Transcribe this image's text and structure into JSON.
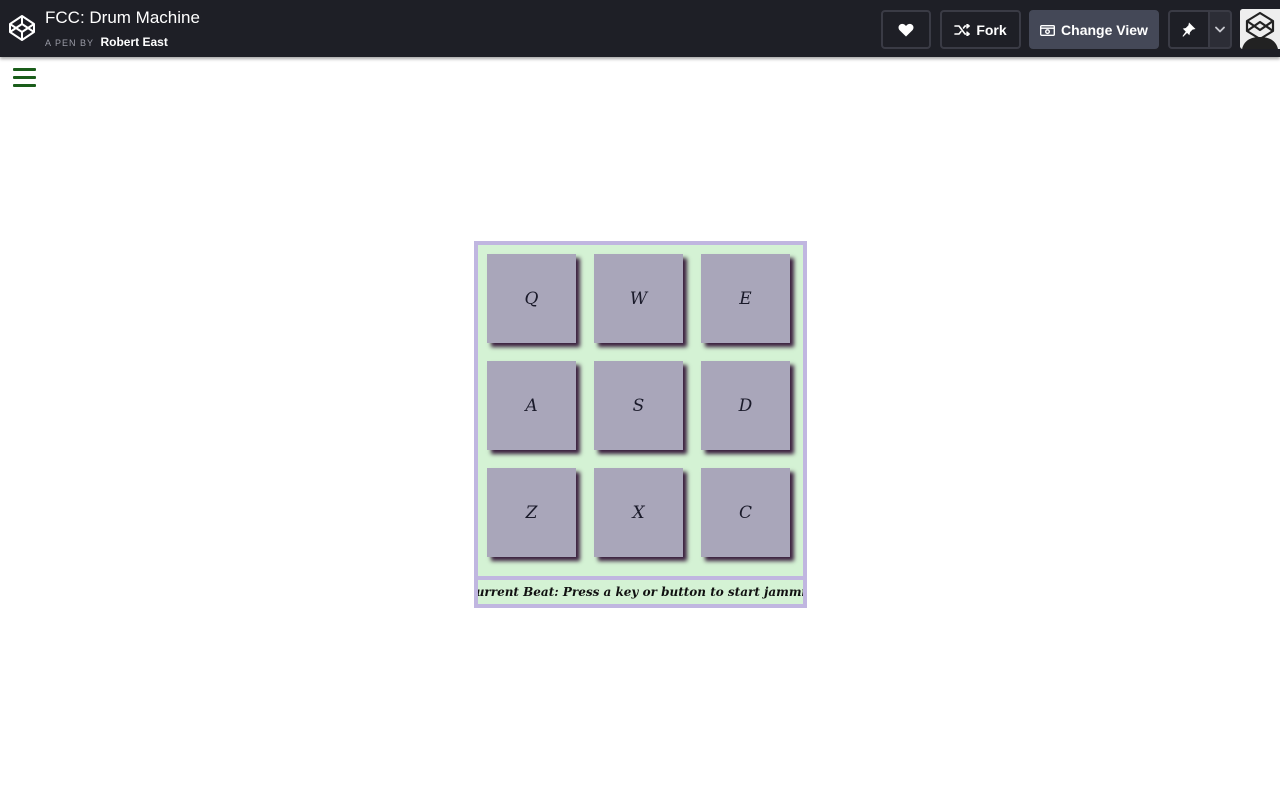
{
  "header": {
    "title": "FCC: Drum Machine",
    "by_label": "A PEN BY",
    "author": "Robert East",
    "logo_icon": "codepen-logo-icon"
  },
  "toolbar": {
    "heart_icon": "heart-icon",
    "fork_label": "Fork",
    "fork_icon": "fork-icon",
    "change_view_label": "Change View",
    "change_view_icon": "change-view-icon",
    "pin_icon": "pin-icon",
    "pin_dropdown_icon": "chevron-down-icon"
  },
  "menu": {
    "icon": "hamburger-menu-icon",
    "color": "#1a5d1a"
  },
  "drum_machine": {
    "pads": [
      "Q",
      "W",
      "E",
      "A",
      "S",
      "D",
      "Z",
      "X",
      "C"
    ],
    "display_text": "Current Beat: Press a key or button to start jammin",
    "colors": {
      "frame": "#c0b6e0",
      "background": "#d4f2d4",
      "pad": "#a9a6ba",
      "pad_shadow": "#3a1f3e"
    }
  }
}
